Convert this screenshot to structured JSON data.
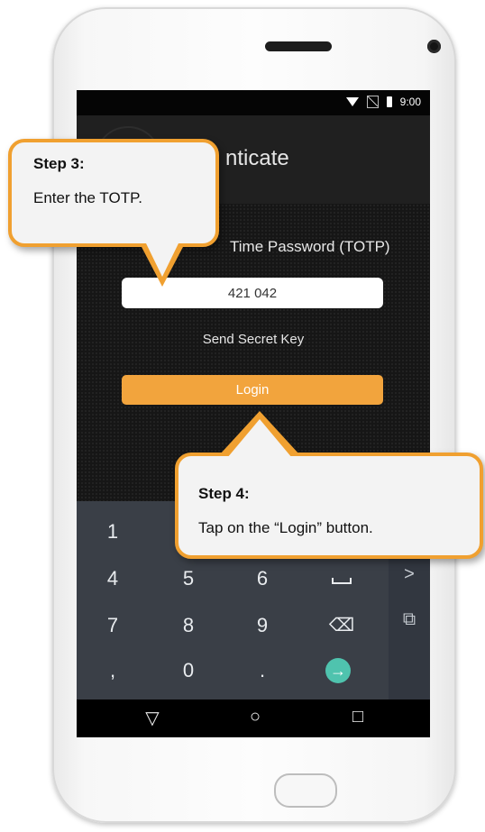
{
  "status": {
    "time": "9:00"
  },
  "app": {
    "title": "nticate"
  },
  "form": {
    "totp_label": "Time Password (TOTP)",
    "totp_value": "421 042",
    "send_key": "Send Secret Key",
    "login": "Login"
  },
  "keyboard": {
    "rows": [
      [
        "1",
        "",
        "",
        ""
      ],
      [
        "4",
        "5",
        "6",
        "␣"
      ],
      [
        "7",
        "8",
        "9",
        "⌫"
      ],
      [
        ",",
        "0",
        ".",
        "→"
      ]
    ],
    "side_icons": [
      "chevron-right-icon",
      "popout-icon"
    ],
    "side_glyphs": [
      ">",
      "⧉"
    ]
  },
  "nav": {
    "back": "▽",
    "home": "○",
    "recents": "□"
  },
  "callouts": {
    "step3": {
      "title": "Step 3:",
      "body": "Enter the TOTP."
    },
    "step4": {
      "title": "Step 4:",
      "body": "Tap on the “Login” button."
    }
  },
  "colors": {
    "accent": "#f2a43d",
    "callout_border": "#f0a030",
    "go_key": "#4fc3ae"
  }
}
